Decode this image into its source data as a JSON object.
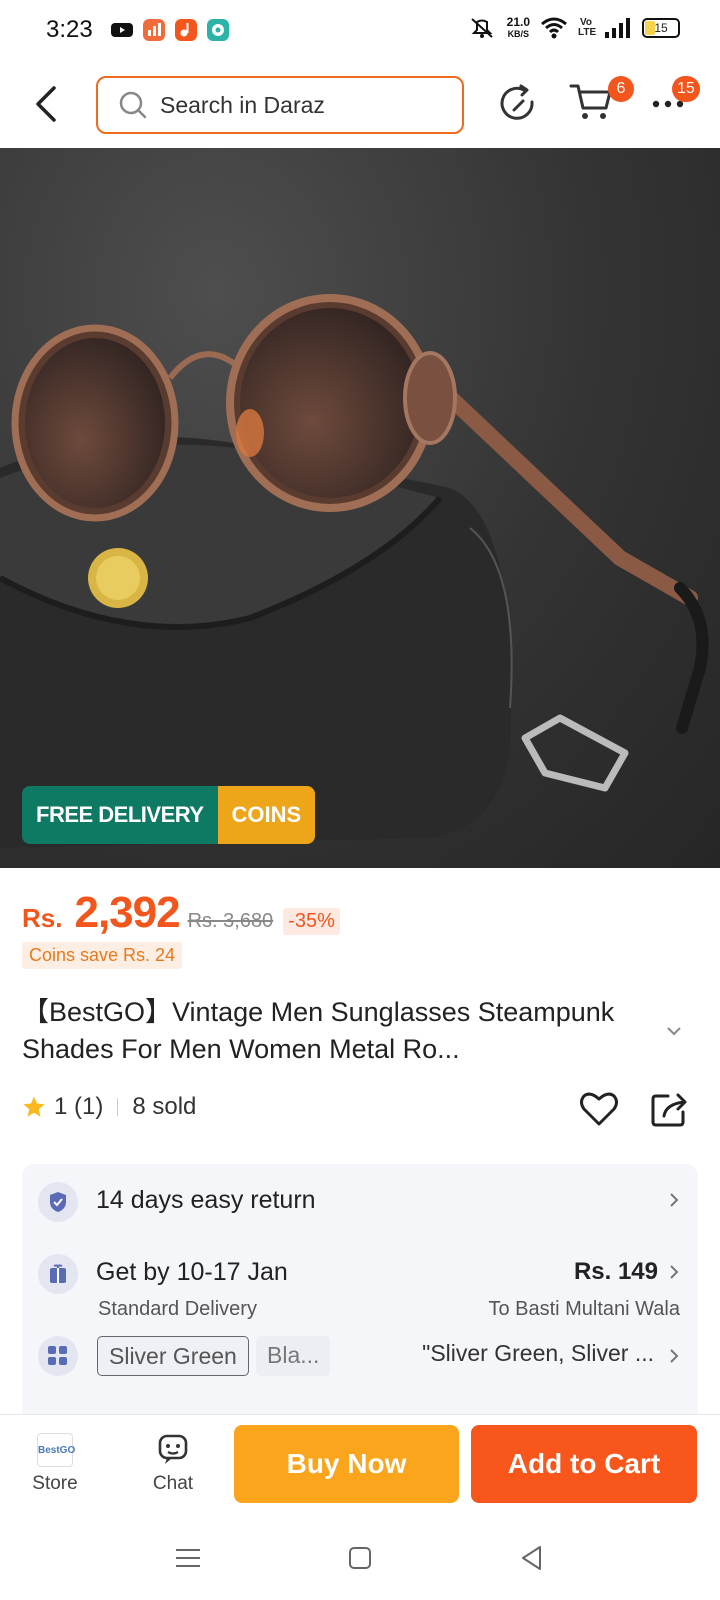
{
  "status_bar": {
    "time": "3:23",
    "net_speed_value": "21.0",
    "net_speed_unit": "KB/S",
    "volte": "Vo LTE",
    "battery": "15"
  },
  "header": {
    "search_placeholder": "Search in Daraz",
    "cart_badge": "6",
    "more_badge": "15"
  },
  "promo": {
    "free_delivery": "FREE DELIVERY",
    "coins": "COINS"
  },
  "product": {
    "currency": "Rs.",
    "price": "2,392",
    "old_price": "Rs. 3,680",
    "discount": "-35%",
    "coins_save": "Coins save Rs. 24",
    "title": "【BestGO】Vintage Men Sunglasses Steampunk Shades For Men Women Metal Ro...",
    "rating": "1 (1)",
    "sold": "8 sold"
  },
  "info": {
    "return": "14 days easy return",
    "delivery_main": "Get by 10-17 Jan",
    "delivery_sub": "Standard Delivery",
    "delivery_price": "Rs. 149",
    "delivery_to": "To Basti Multani Wala",
    "variant_selected": "Sliver Green",
    "variant_other": "Bla...",
    "variant_summary": "\"Sliver Green, Sliver ..."
  },
  "bottom": {
    "store": "Store",
    "store_logo": "BestGO",
    "chat": "Chat",
    "buy_now": "Buy Now",
    "add_to_cart": "Add to Cart"
  },
  "colors": {
    "accent": "#f8561b",
    "buy_now": "#fba51d",
    "free_delivery": "#0f7a63",
    "coins": "#eda51a"
  }
}
